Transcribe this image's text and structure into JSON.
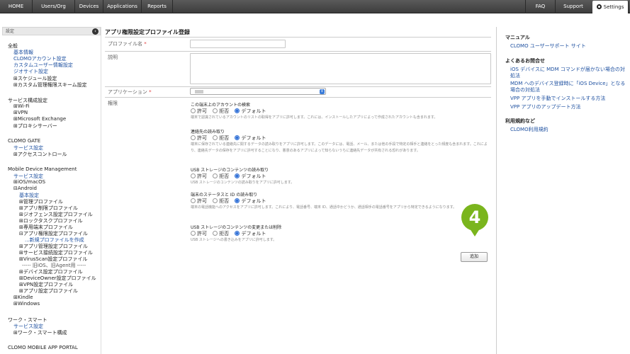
{
  "nav": {
    "home": "HOME",
    "users": "Users/Org",
    "devices": "Devices",
    "applications": "Applications",
    "reports": "Reports",
    "faq": "FAQ",
    "support": "Support",
    "settings": "Settings"
  },
  "sidebar": {
    "header": "設定",
    "items": [
      "全般",
      "基本情報",
      "CLOMOアカウント設定",
      "カスタムユーザー情報設定",
      "ジオサイト設定",
      "⊞スケジュール設定",
      "⊞カスタム管理権限スキーム設定",
      "サービス構成設定",
      "⊞Wi-Fi",
      "⊞VPN",
      "⊞Microsoft Exchange",
      "⊞プロキシサーバー",
      "CLOMO GATE",
      "サービス設定",
      "⊞アクセスコントロール",
      "Mobile Device Management",
      "サービス設定",
      "⊞iOS/macOS",
      "⊟Android",
      "基本設定",
      "⊞管理プロファイル",
      "⊞アプリ制限プロファイル",
      "⊞ジオフェンス設定プロファイル",
      "⊞ロックタスクプロファイル",
      "⊞専用端末プロファイル",
      "⊟アプリ権限設定プロファイル",
      "...新規プロファイルを作成",
      "⊞アプリ管理設定プロファイル",
      "⊞サービス接続設定プロファイル",
      "⊞VirusScan設定プロファイル",
      "----- 旧iOS、旧Agent用 -----",
      "⊞デバイス設定プロファイル",
      "⊞DeviceOwner設定プロファイル",
      "⊞VPN設定プロファイル",
      "⊞アプリ設定プロファイル",
      "⊞Kindle",
      "⊞Windows",
      "ワーク・スマート",
      "サービス設定",
      "⊞ワーク・スマート構成",
      "CLOMO MOBILE APP PORTAL"
    ]
  },
  "main": {
    "title": "アプリ権限設定プロファイル登録",
    "profile_name_label": "プロファイル名",
    "required_mark": "*",
    "description_label": "説明",
    "application_label": "アプリケーション",
    "permission_label": "権限",
    "radio_allow": "許可",
    "radio_deny": "拒否",
    "radio_default": "デフォルト",
    "permissions": [
      {
        "title": "この端末上のアカウントの検索",
        "desc": "端末で認識されているアカウントのリストの取得をアプリに許可します。これには、インストールしたアプリによって作成されたアカウントも含まれます。"
      },
      {
        "title": "連絡先の読み取り",
        "desc": "端末に保存されている連絡先に関するデータの読み取りをアプリに許可します。このデータには、電話、メール、または他の手段で特定の相手と連絡をとった頻度も含まれます。これにより、連絡先データの保存をアプリに許可することになり、悪意のあるアプリによって知らないうちに連絡先データが共有される恐れがあります。"
      },
      {
        "title": "USB ストレージのコンテンツの読み取り",
        "desc": "USB ストレージのコンテンツの読み取りをアプリに許可します。"
      },
      {
        "title": "端末のステータスと ID の読み取り",
        "desc": "端末の電話機能へのアクセスをアプリに許可します。これにより、電話番号、端末 ID、通話中かどうか、通話相手の電話番号をアプリから特定できるようになります。"
      },
      {
        "title": "USB ストレージのコンテンツの変更または削除",
        "desc": "USB ストレージへの書き込みをアプリに許可します。"
      }
    ],
    "add_button": "追加",
    "step_number": "4"
  },
  "right": {
    "manual_heading": "マニュアル",
    "manual_link": "CLOMO ユーザーサポート サイト",
    "faq_heading": "よくあるお問合せ",
    "faq_links": [
      "iOS デバイスに MDM コマンドが届かない場合の対",
      "処法",
      "MDM へのデバイス登録時に「iOS Device」となる",
      "場合の対処法",
      "VPP アプリを手動でインストールする方法",
      "VPP アプリのアップデート方法"
    ],
    "terms_heading": "利用規約など",
    "terms_link": "CLOMO利用規約"
  },
  "colors": {
    "step_badge": "#7ab51d",
    "link": "#1e50a0",
    "required": "#e03a3a",
    "radio_selected": "#2f6fd6"
  }
}
